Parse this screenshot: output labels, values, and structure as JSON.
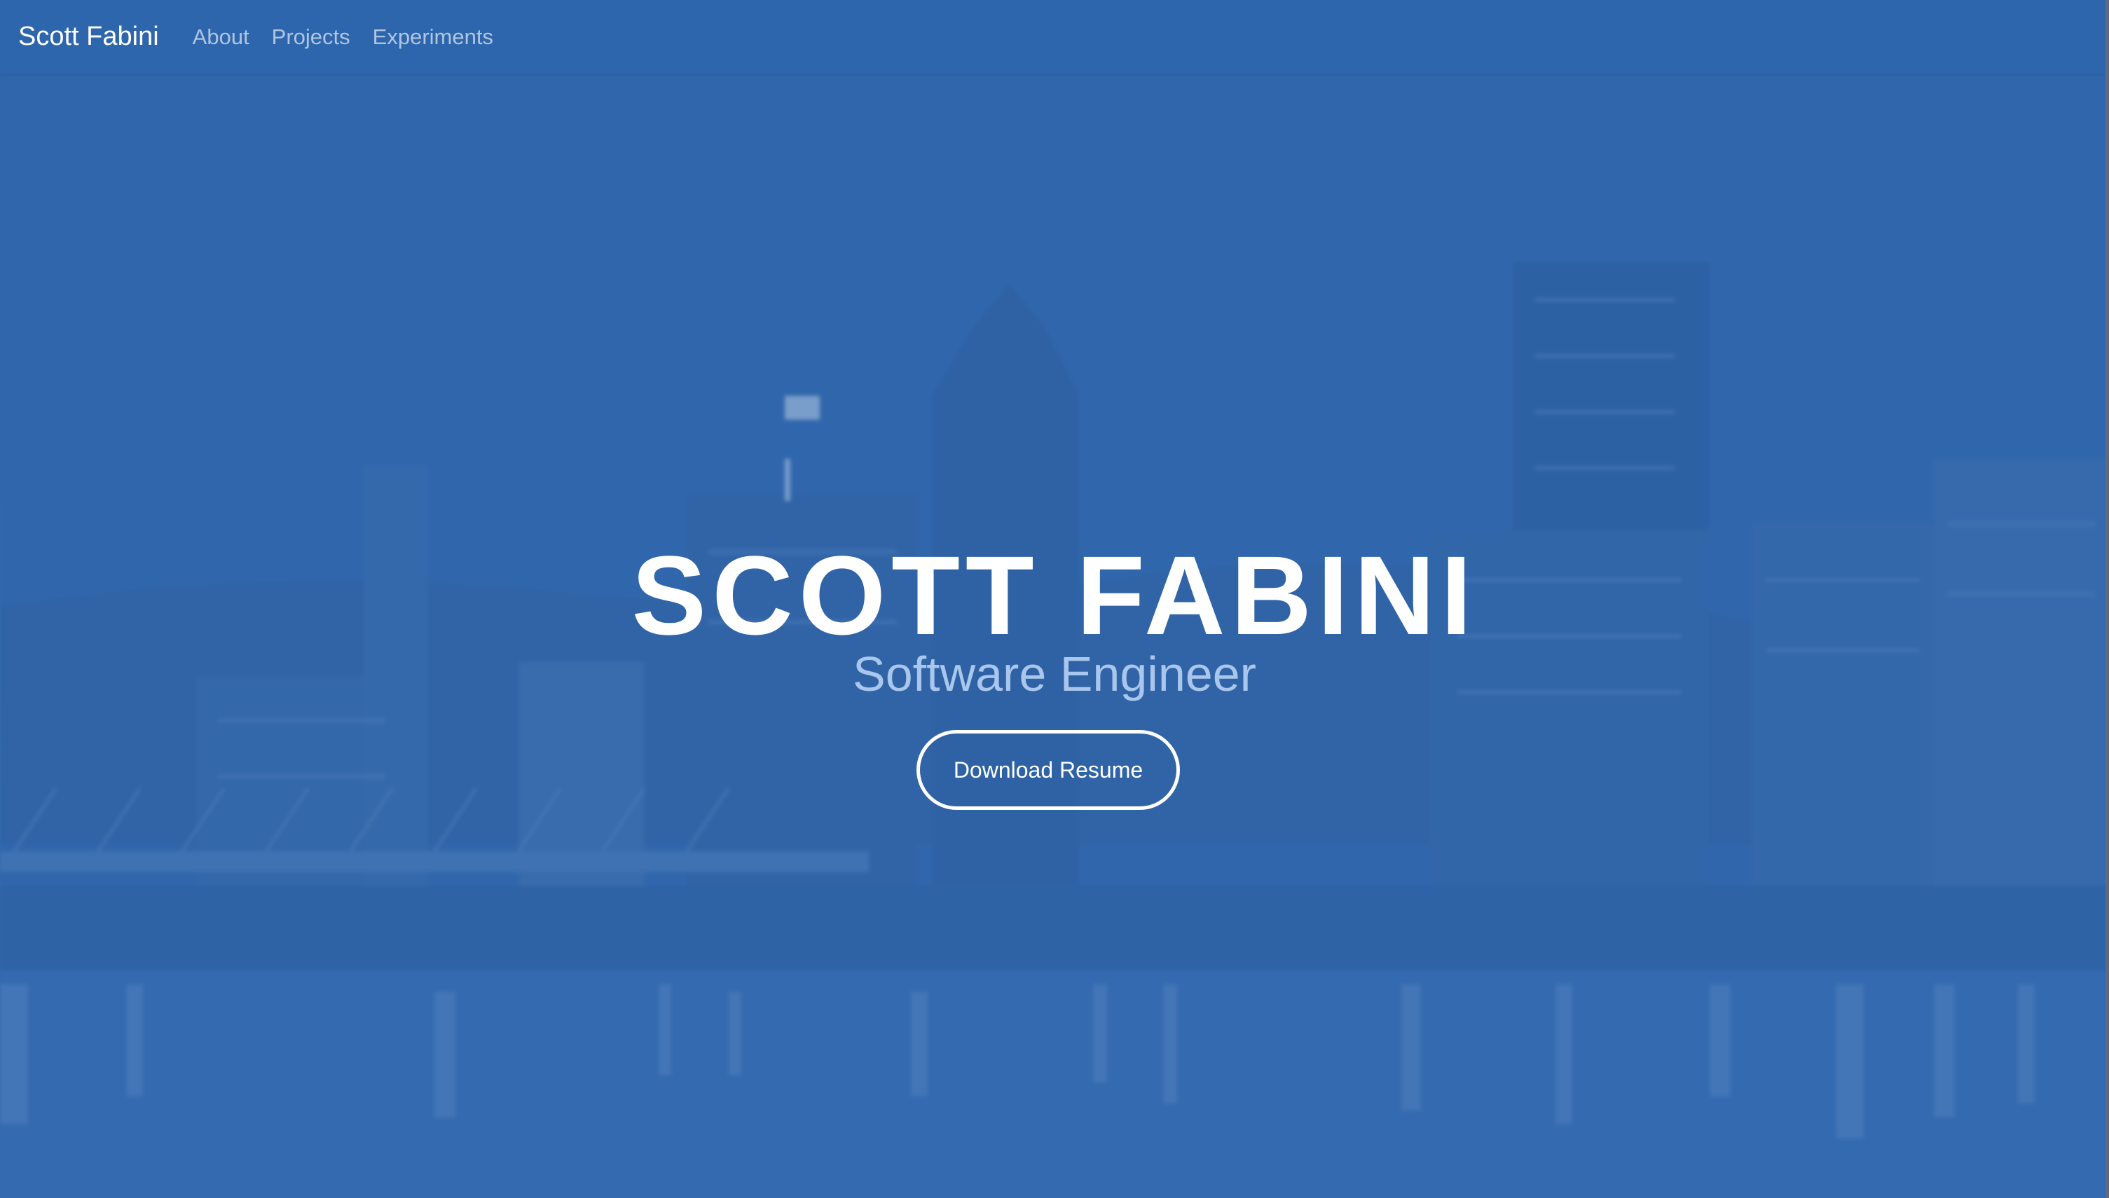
{
  "navbar": {
    "brand": "Scott Fabini",
    "links": [
      {
        "label": "About"
      },
      {
        "label": "Projects"
      },
      {
        "label": "Experiments"
      }
    ]
  },
  "hero": {
    "title": "SCOTT FABINI",
    "subtitle": "Software Engineer",
    "cta_label": "Download Resume",
    "background_image": "city-skyline-at-dusk-with-river"
  },
  "colors": {
    "navbar": "#2e66ad",
    "overlay": "#2e66ad",
    "title": "#ffffff",
    "subtitle": "#a9c6ec",
    "nav_link": "#c3d4ea"
  }
}
